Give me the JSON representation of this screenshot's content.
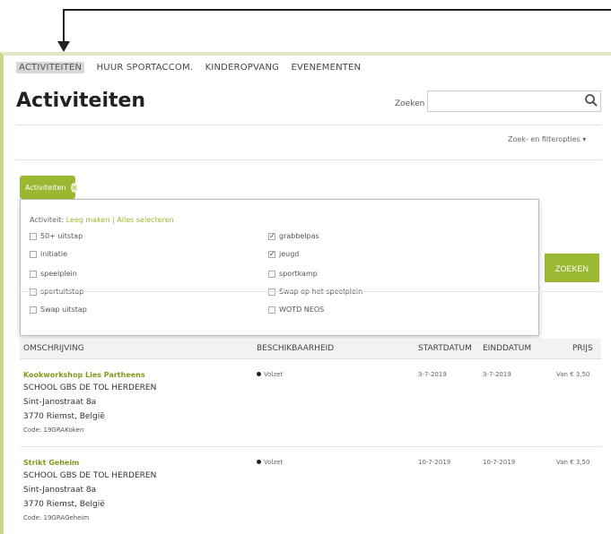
{
  "nav": {
    "items": [
      "ACTIVITEITEN",
      "HUUR SPORTACCOM.",
      "KINDEROPVANG",
      "EVENEMENTEN"
    ]
  },
  "page": {
    "title": "Activiteiten"
  },
  "search": {
    "label": "Zoeken",
    "placeholder": "",
    "icon": "search-icon"
  },
  "filters": {
    "link_label": "Zoek- en filteropties ▾"
  },
  "tag": {
    "label": "Activiteiten",
    "remove_symbol": "×"
  },
  "dropdown": {
    "heading_prefix": "Activiteit:",
    "clear_label": "Leeg maken",
    "separator": " | ",
    "select_all_label": "Alles selecteren",
    "left_options": [
      {
        "label": "50+ uitstap",
        "checked": false
      },
      {
        "label": "initiatie",
        "checked": false
      },
      {
        "label": "speelplein",
        "checked": false
      },
      {
        "label": "sportuitstap",
        "checked": false
      },
      {
        "label": "Swap uitstap",
        "checked": false
      }
    ],
    "right_options": [
      {
        "label": "grabbelpas",
        "checked": true
      },
      {
        "label": "jeugd",
        "checked": true
      },
      {
        "label": "sportkamp",
        "checked": false
      },
      {
        "label": "Swap op het speelplein",
        "checked": false
      },
      {
        "label": "WOTD NEOS",
        "checked": false
      }
    ]
  },
  "search_button": {
    "label": "ZOEKEN"
  },
  "table": {
    "headers": [
      "OMSCHRIJVING",
      "BESCHIKBAARHEID",
      "STARTDATUM",
      "EINDDATUM",
      "PRIJS"
    ],
    "rows": [
      {
        "title": "Kookworkshop Lies Partheens",
        "school": "SCHOOL GBS DE TOL HERDEREN",
        "street": "Sint-Janostraat 8a",
        "city": "3770 Riemst, België",
        "code": "Code: 19GRAKoken",
        "availability": "Volzet",
        "start": "3-7-2019",
        "end": "3-7-2019",
        "price": "Van € 3,50"
      },
      {
        "title": "Strikt Geheim",
        "school": "SCHOOL GBS DE TOL HERDEREN",
        "street": "Sint-Janostraat 8a",
        "city": "3770 Riemst, België",
        "code": "Code: 19GRAGeheim",
        "availability": "Volzet",
        "start": "10-7-2019",
        "end": "10-7-2019",
        "price": "Van € 3,50"
      }
    ]
  },
  "colors": {
    "accent": "#9ab832",
    "link": "#7d9a1e"
  }
}
